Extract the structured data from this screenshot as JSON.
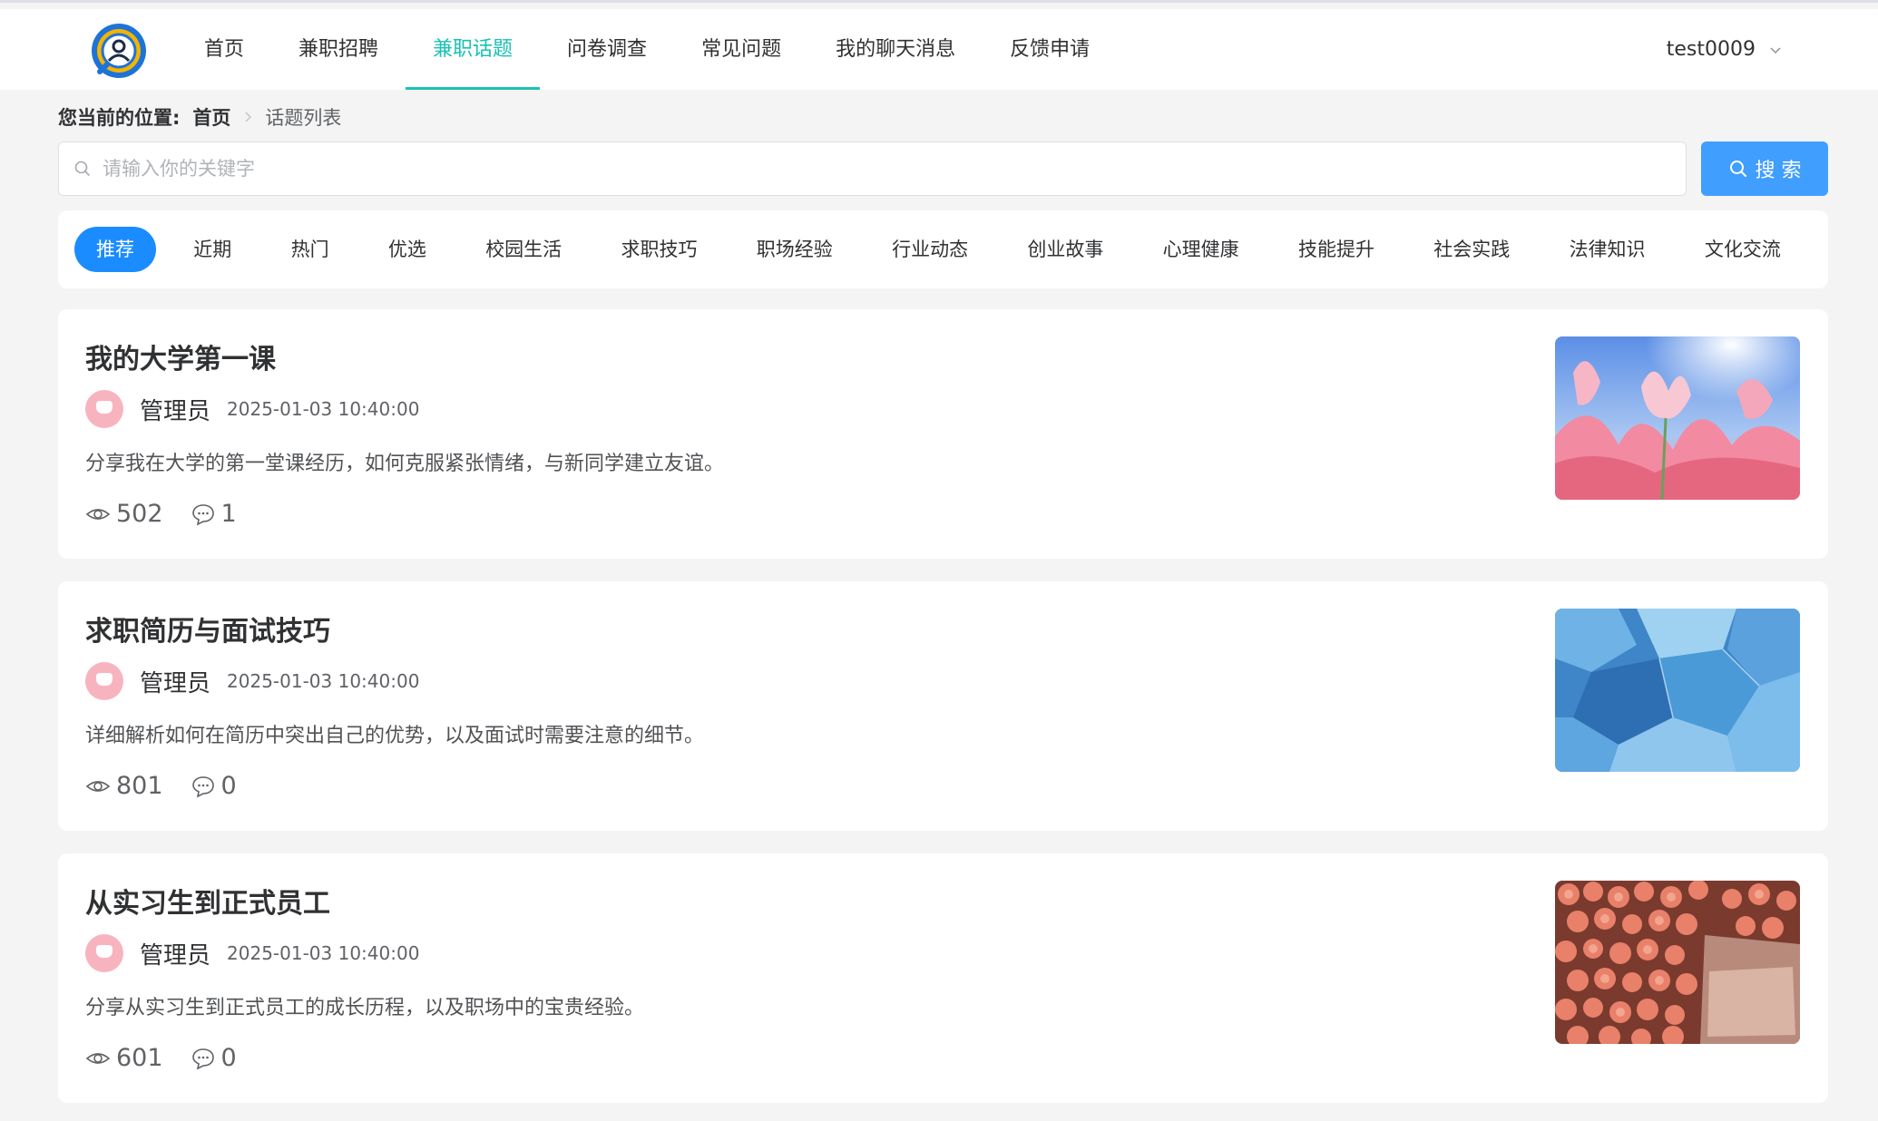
{
  "nav": {
    "items": [
      {
        "label": "首页"
      },
      {
        "label": "兼职招聘"
      },
      {
        "label": "兼职话题"
      },
      {
        "label": "问卷调查"
      },
      {
        "label": "常见问题"
      },
      {
        "label": "我的聊天消息"
      },
      {
        "label": "反馈申请"
      }
    ],
    "active_index": 2,
    "username": "test0009"
  },
  "breadcrumb": {
    "prefix": "您当前的位置:",
    "home": "首页",
    "current": "话题列表"
  },
  "search": {
    "placeholder": "请输入你的关键字",
    "value": "",
    "button_label": "搜 索"
  },
  "tabs": {
    "items": [
      "推荐",
      "近期",
      "热门",
      "优选",
      "校园生活",
      "求职技巧",
      "职场经验",
      "行业动态",
      "创业故事",
      "心理健康",
      "技能提升",
      "社会实践",
      "法律知识",
      "文化交流"
    ],
    "active_index": 0
  },
  "topics": [
    {
      "title": "我的大学第一课",
      "author": "管理员",
      "date": "2025-01-03 10:40:00",
      "desc": "分享我在大学的第一堂课经历，如何克服紧张情绪，与新同学建立友谊。",
      "views": "502",
      "comments": "1",
      "image": "pink-flowers"
    },
    {
      "title": "求职简历与面试技巧",
      "author": "管理员",
      "date": "2025-01-03 10:40:00",
      "desc": "详细解析如何在简历中突出自己的优势，以及面试时需要注意的细节。",
      "views": "801",
      "comments": "0",
      "image": "blue-ice"
    },
    {
      "title": "从实习生到正式员工",
      "author": "管理员",
      "date": "2025-01-03 10:40:00",
      "desc": "分享从实习生到正式员工的成长历程，以及职场中的宝贵经验。",
      "views": "601",
      "comments": "0",
      "image": "peach-roses"
    }
  ],
  "colors": {
    "accent": "#19c1b6",
    "primary": "#409eff",
    "tab_active": "#1a8cff"
  }
}
